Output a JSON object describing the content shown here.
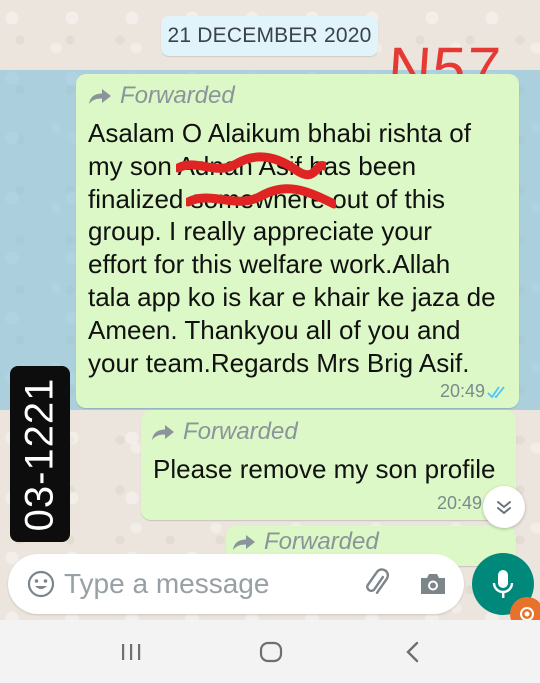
{
  "date_chip": "21 DECEMBER 2020",
  "stamp": "N57",
  "forwarded_label": "Forwarded",
  "messages": [
    {
      "forwarded": true,
      "lines": [
        "Asalam O Alaikum bhabi rishta of",
        "my son Adnan Asif has been",
        "finalized somewhere out of this",
        "group. I really appreciate your",
        "effort for this welfare  work.Allah",
        "tala app ko is kar e khair ke jaza de",
        "Ameen. Thankyou all of you and",
        "your team.Regards Mrs Brig Asif."
      ],
      "time": "20:49",
      "status": "read"
    },
    {
      "forwarded": true,
      "text": "Please remove my son profile",
      "time": "20:49"
    }
  ],
  "phone_badge": "03-1221",
  "input": {
    "placeholder": "Type a message"
  },
  "icons": {
    "emoji": "emoji-icon",
    "attach": "paperclip-icon",
    "camera": "camera-icon",
    "mic": "microphone-icon",
    "scroll": "chevron-down-icon"
  },
  "colors": {
    "bubble": "#dcf8c6",
    "mic": "#00897b",
    "read_ticks": "#4fc3f7",
    "stamp": "#e53935",
    "selection": "#78bedc"
  }
}
